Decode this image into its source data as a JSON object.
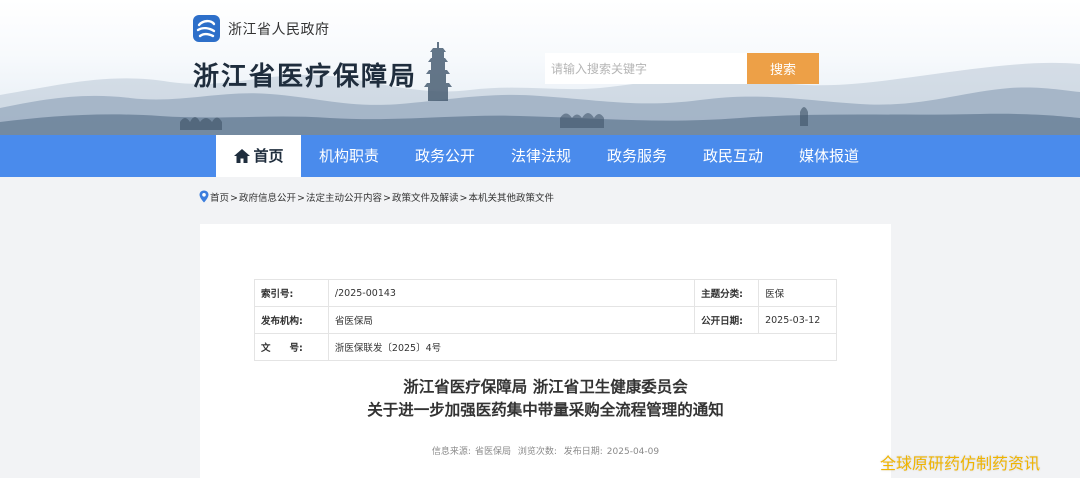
{
  "header": {
    "gov_name": "浙江省人民政府",
    "site_title": "浙江省医疗保障局",
    "search": {
      "placeholder": "请输入搜索关键字",
      "button": "搜索"
    }
  },
  "nav": {
    "items": [
      {
        "label": "首页",
        "icon": "home-icon",
        "active": true
      },
      {
        "label": "机构职责"
      },
      {
        "label": "政务公开"
      },
      {
        "label": "法律法规"
      },
      {
        "label": "政务服务"
      },
      {
        "label": "政民互动"
      },
      {
        "label": "媒体报道"
      }
    ]
  },
  "breadcrumb": {
    "icon": "location-pin-icon",
    "items": [
      "首页",
      "政府信息公开",
      "法定主动公开内容",
      "政策文件及解读",
      "本机关其他政策文件"
    ],
    "separator": ">"
  },
  "meta": {
    "index_label": "索引号:",
    "index_value": "/2025-00143",
    "topic_label": "主题分类:",
    "topic_value": "医保",
    "org_label": "发布机构:",
    "org_value": "省医保局",
    "date_label": "公开日期:",
    "date_value": "2025-03-12",
    "docno_label": "文　　号:",
    "docno_value": "浙医保联发〔2025〕4号"
  },
  "article": {
    "title_line1": "浙江省医疗保障局 浙江省卫生健康委员会",
    "title_line2": "关于进一步加强医药集中带量采购全流程管理的通知",
    "source_label": "信息来源:",
    "source_value": "省医保局",
    "views_label": "浏览次数:",
    "publish_label": "发布日期:",
    "publish_value": "2025-04-09"
  },
  "watermark": "全球原研药仿制药资讯",
  "colors": {
    "nav_bg": "#4a8bec",
    "search_button": "#eda047",
    "logo_bg": "#2d6fc9",
    "watermark": "#f0b400"
  }
}
